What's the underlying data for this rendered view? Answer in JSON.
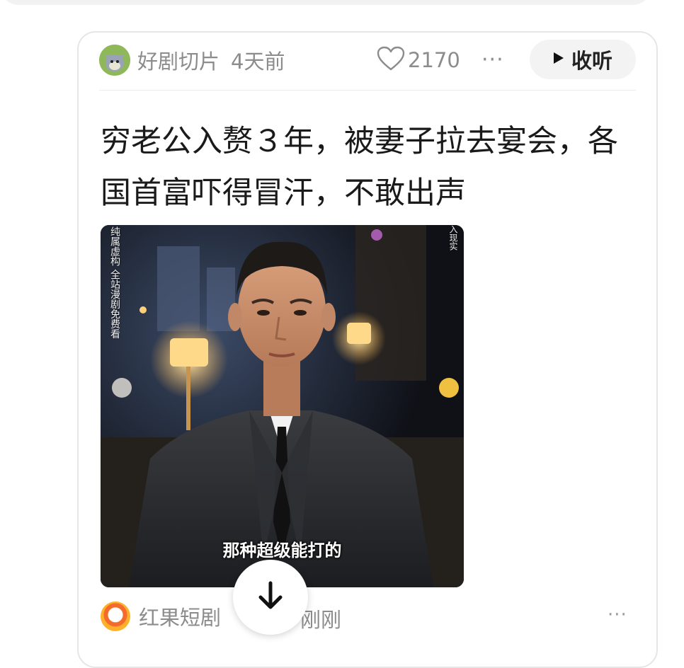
{
  "post": {
    "author": "好剧切片",
    "time": "4天前",
    "likes": "2170",
    "more": "···",
    "listen_label": "收听",
    "title": "穷老公入赘３年，被妻子拉去宴会，各国首富吓得冒汗，不敢出声",
    "video": {
      "side_caption": "纯属虚构 全站漫剧免费看",
      "corner_caption": "入现实",
      "subtitle": "那种超级能打的"
    }
  },
  "next_post": {
    "source": "红果短剧",
    "time": "刚刚",
    "more": "···"
  },
  "colors": {
    "meta_text": "#8c8c8c",
    "title_text": "#1a1a1a",
    "button_bg": "#f3f3f3"
  }
}
